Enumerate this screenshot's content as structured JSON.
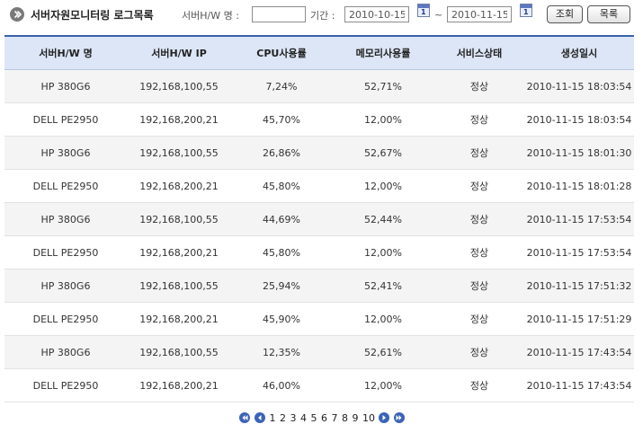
{
  "header": {
    "title": "서버자원모니터링 로그목록",
    "server_name_label": "서버H/W 명 :",
    "server_name_value": "",
    "period_label": "기간 :",
    "date_from": "2010-10-15",
    "date_separator": "~",
    "date_to": "2010-11-15",
    "calendar_day": "1",
    "search_button": "조회",
    "list_button": "목록"
  },
  "table": {
    "columns": [
      "서버H/W 명",
      "서버H/W IP",
      "CPU사용률",
      "메모리사용률",
      "서비스상태",
      "생성일시"
    ],
    "rows": [
      [
        "HP 380G6",
        "192,168,100,55",
        "7,24%",
        "52,71%",
        "정상",
        "2010-11-15 18:03:54"
      ],
      [
        "DELL PE2950",
        "192,168,200,21",
        "45,70%",
        "12,00%",
        "정상",
        "2010-11-15 18:03:54"
      ],
      [
        "HP 380G6",
        "192,168,100,55",
        "26,86%",
        "52,67%",
        "정상",
        "2010-11-15 18:01:30"
      ],
      [
        "DELL PE2950",
        "192,168,200,21",
        "45,80%",
        "12,00%",
        "정상",
        "2010-11-15 18:01:28"
      ],
      [
        "HP 380G6",
        "192,168,100,55",
        "44,69%",
        "52,44%",
        "정상",
        "2010-11-15 17:53:54"
      ],
      [
        "DELL PE2950",
        "192,168,200,21",
        "45,80%",
        "12,00%",
        "정상",
        "2010-11-15 17:53:54"
      ],
      [
        "HP 380G6",
        "192,168,100,55",
        "25,94%",
        "52,41%",
        "정상",
        "2010-11-15 17:51:32"
      ],
      [
        "DELL PE2950",
        "192,168,200,21",
        "45,90%",
        "12,00%",
        "정상",
        "2010-11-15 17:51:29"
      ],
      [
        "HP 380G6",
        "192,168,100,55",
        "12,35%",
        "52,61%",
        "정상",
        "2010-11-15 17:43:54"
      ],
      [
        "DELL PE2950",
        "192,168,200,21",
        "46,00%",
        "12,00%",
        "정상",
        "2010-11-15 17:43:54"
      ]
    ]
  },
  "pagination": {
    "pages": [
      "1",
      "2",
      "3",
      "4",
      "5",
      "6",
      "7",
      "8",
      "9",
      "10"
    ],
    "icons": [
      "first-page-icon",
      "prev-page-icon",
      "next-page-icon",
      "last-page-icon"
    ]
  },
  "colors": {
    "header_bg": "#dce6f6",
    "accent": "#3a62a8",
    "pager_icon": "#3b63b8"
  }
}
